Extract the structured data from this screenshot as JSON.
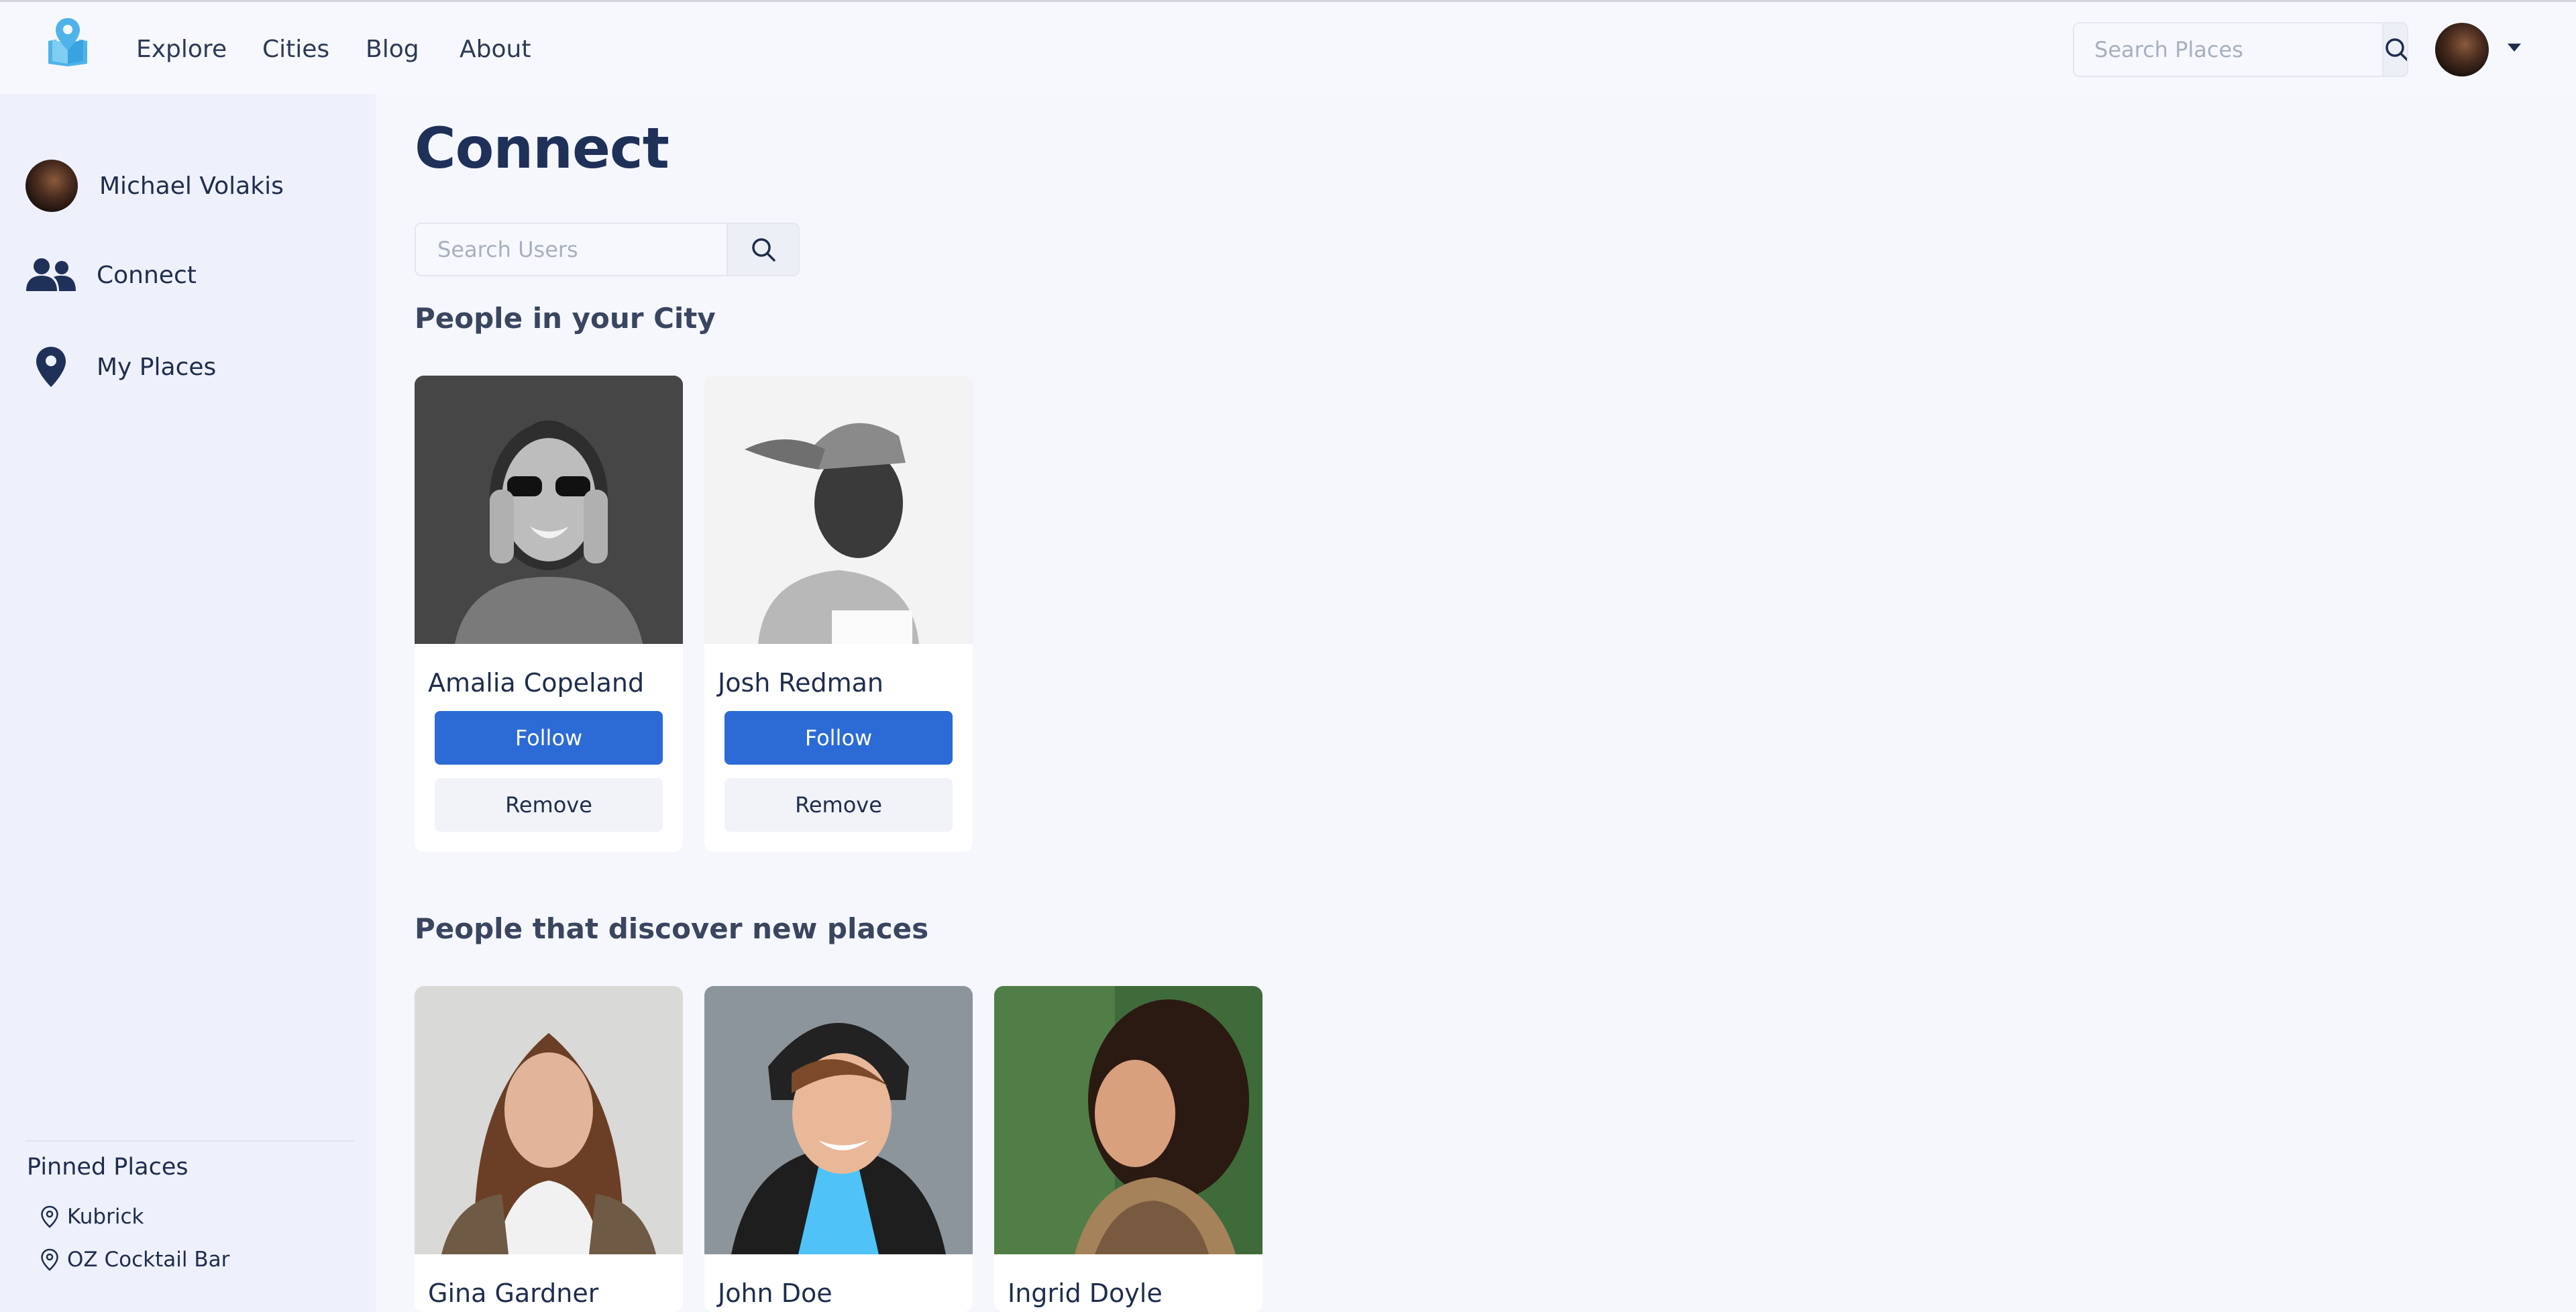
{
  "header": {
    "logo_icon": "map-book-pin-icon",
    "nav": [
      "Explore",
      "Cities",
      "Blog",
      "About"
    ],
    "search_placeholder": "Search Places",
    "search_icon": "search-icon",
    "avatar_menu_icon": "caret-down-icon"
  },
  "sidebar": {
    "user_name": "Michael Volakis",
    "items": [
      {
        "label": "Connect",
        "icon": "users-icon"
      },
      {
        "label": "My Places",
        "icon": "map-marker-icon"
      }
    ],
    "pinned_title": "Pinned Places",
    "pinned": [
      "Kubrick",
      "OZ Cocktail Bar"
    ]
  },
  "main": {
    "title": "Connect",
    "search_placeholder": "Search Users",
    "section_city": "People in your City",
    "section_discover": "People that discover new places",
    "follow_label": "Follow",
    "remove_label": "Remove",
    "city_people": [
      "Amalia Copeland",
      "Josh Redman"
    ],
    "discover_people": [
      "Gina Gardner",
      "John Doe",
      "Ingrid Doyle"
    ]
  },
  "colors": {
    "brand_blue": "#2c6ad6",
    "logo_blue": "#4fb3ea",
    "heading": "#1f3159",
    "background": "#f5f7fd",
    "sidebar": "#eef1fb"
  }
}
